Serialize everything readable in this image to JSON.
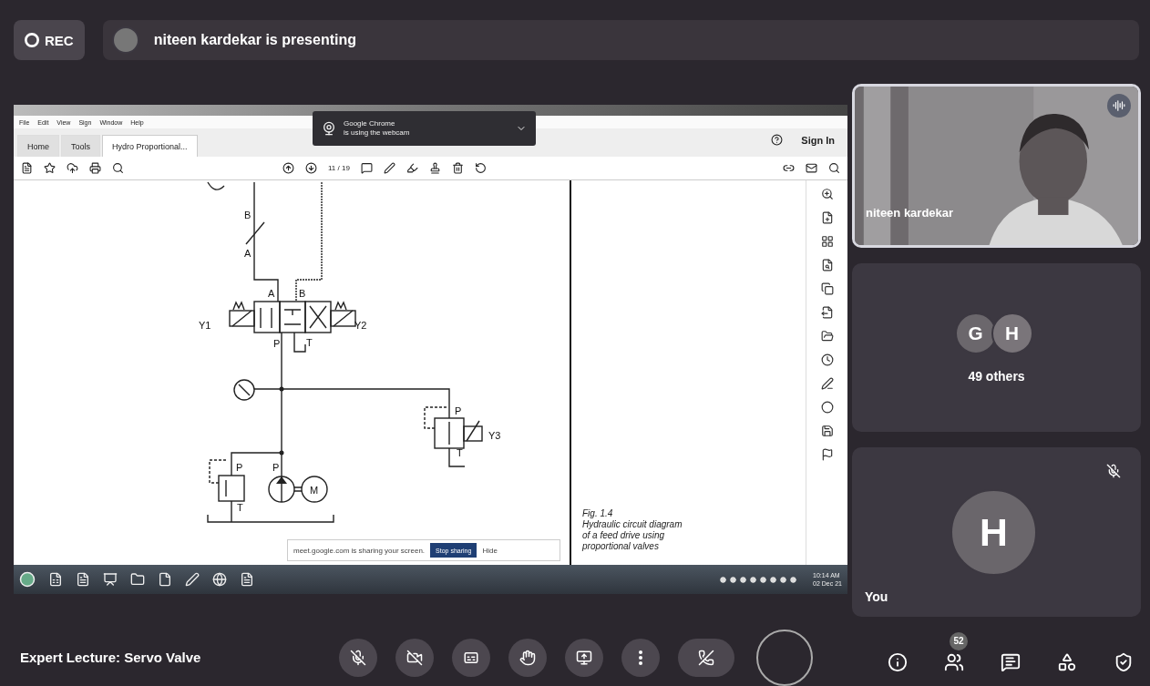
{
  "recording": {
    "label": "REC"
  },
  "presenter_banner": {
    "text": "niteen kardekar is presenting"
  },
  "shared_screen": {
    "app_window": {
      "menu": [
        "File",
        "Edit",
        "View",
        "Sign",
        "Window",
        "Help"
      ],
      "tabs": [
        {
          "label": "Home",
          "selected": false
        },
        {
          "label": "Tools",
          "selected": false
        },
        {
          "label": "Hydro Proportional...",
          "selected": true
        }
      ],
      "page_indicator": "11 / 19",
      "sign_in": "Sign In",
      "diagram_labels": [
        "B",
        "A",
        "A",
        "B",
        "Y1",
        "Y2",
        "P",
        "T",
        "P",
        "Y3",
        "T",
        "P",
        "P",
        "M",
        "T"
      ],
      "caption": [
        "Fig. 1.4",
        "Hydraulic circuit diagram",
        "of a feed drive using",
        "proportional valves"
      ]
    },
    "webcam_notice": {
      "title": "Google Chrome",
      "text": "is using the webcam"
    },
    "sharing_bar": {
      "text": "meet.google.com is sharing your screen.",
      "stop_button": "Stop sharing",
      "hide_button": "Hide"
    },
    "taskbar": {
      "time": "10:14 AM",
      "date": "02 Dec 21"
    }
  },
  "participants": [
    {
      "kind": "video",
      "name": "niteen kardekar",
      "speaking": true
    },
    {
      "kind": "group",
      "avatars": [
        "G",
        "H"
      ],
      "label": "49 others"
    },
    {
      "kind": "self",
      "avatar": "H",
      "name": "You",
      "muted": true
    }
  ],
  "meeting_title": "Expert Lecture: Servo Valve",
  "controls": {
    "mic_on": false,
    "camera_on": false
  },
  "people_count": "52"
}
